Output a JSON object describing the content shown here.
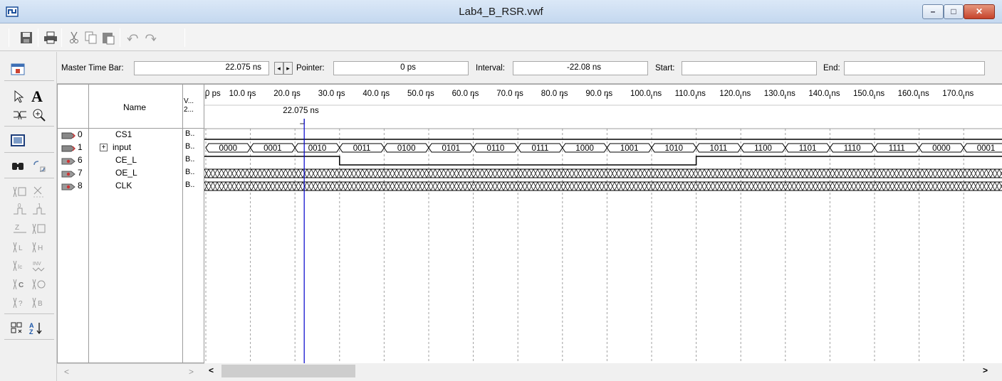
{
  "window": {
    "title": "Lab4_B_RSR.vwf",
    "min_glyph": "–",
    "max_glyph": "□",
    "close_glyph": "✕"
  },
  "toolbar": {
    "icons": [
      "save-icon",
      "print-icon",
      "cut-icon",
      "copy-icon",
      "paste-icon",
      "undo-icon",
      "redo-icon"
    ]
  },
  "palette": {
    "icons": [
      "selection-tool-icon",
      "text-tool-icon",
      "waveform-editing-tool-icon",
      "zoom-tool-icon",
      "full-screen-icon",
      "find-icon",
      "replace-icon",
      "uninitialized-icon",
      "forcing-unknown-icon",
      "forcing-low-icon",
      "forcing-high-icon",
      "high-impedance-icon",
      "weak-unknown-icon",
      "weak-low-icon",
      "weak-high-icon",
      "invert-icon",
      "count-value-icon",
      "clock-value-icon",
      "arbitrary-value-icon",
      "random-value-icon",
      "snap-to-grid-icon",
      "sort-icon"
    ],
    "text_glyph": "A"
  },
  "timebar": {
    "master_label": "Master Time Bar:",
    "master_value": "22.075 ns",
    "pointer_label": "Pointer:",
    "pointer_value": "0 ps",
    "interval_label": "Interval:",
    "interval_value": "-22.08 ns",
    "start_label": "Start:",
    "start_value": "",
    "end_label": "End:",
    "end_value": ""
  },
  "table": {
    "name_header": "Name",
    "value_header": "V... 2...",
    "rows": [
      {
        "num": "0",
        "name": "CS1",
        "value": "B..",
        "pin": "input",
        "expand": false
      },
      {
        "num": "1",
        "name": "input",
        "value": "B..",
        "pin": "input-bus",
        "expand": true,
        "expand_glyph": "+"
      },
      {
        "num": "6",
        "name": "CE_L",
        "value": "B..",
        "pin": "output",
        "expand": false
      },
      {
        "num": "7",
        "name": "OE_L",
        "value": "B..",
        "pin": "output",
        "expand": false
      },
      {
        "num": "8",
        "name": "CLK",
        "value": "B..",
        "pin": "output",
        "expand": false
      }
    ]
  },
  "scroll": {
    "left_arrow": "<",
    "right_arrow": ">"
  },
  "waveform": {
    "time_labels": [
      "0 ps",
      "10.0 ns",
      "20.0 ns",
      "30.0 ns",
      "40.0 ns",
      "50.0 ns",
      "60.0 ns",
      "70.0 ns",
      "80.0 ns",
      "90.0 ns",
      "100.0 ns",
      "110.0 ns",
      "120.0 ns",
      "130.0 ns",
      "140.0 ns",
      "150.0 ns",
      "160.0 ns",
      "170.0 ns"
    ],
    "master_marker_label": "22.075 ns",
    "master_time_ns": 22.075,
    "ns_per_segment": 10,
    "input_bus_values": [
      "0000",
      "0001",
      "0010",
      "0011",
      "0100",
      "0101",
      "0110",
      "0111",
      "1000",
      "1001",
      "1010",
      "1011",
      "1100",
      "1101",
      "1110",
      "1111",
      "0000",
      "0001"
    ],
    "ce_l_low_from_ns": 30,
    "ce_l_low_to_ns": 110,
    "colors": {
      "marker": "#0000cc",
      "wave": "#000000",
      "grid": "#a0a0a0"
    }
  }
}
